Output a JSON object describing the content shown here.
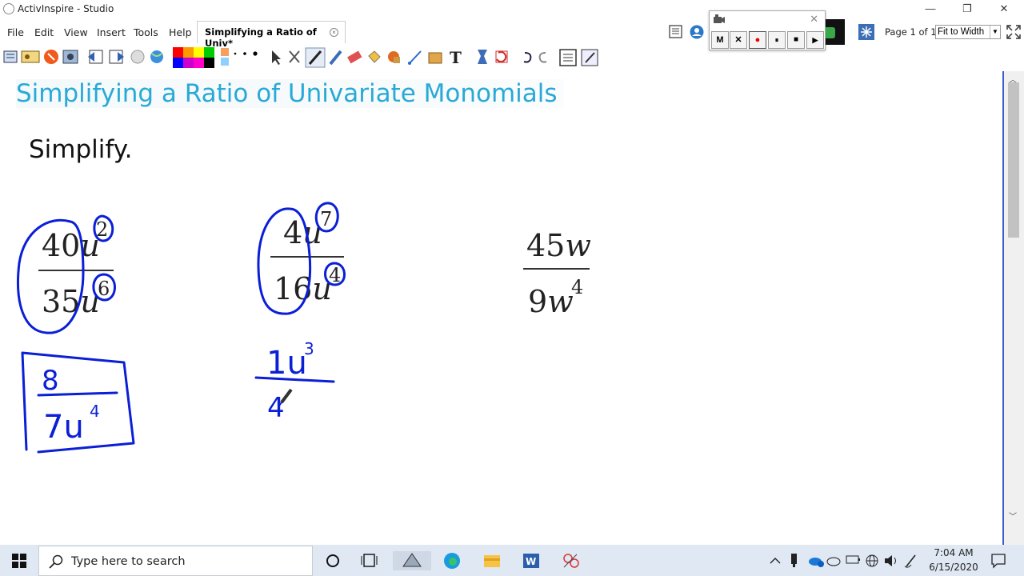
{
  "window": {
    "title": "ActivInspire - Studio",
    "minimize_glyph": "—",
    "maximize_glyph": "❐",
    "close_glyph": "✕"
  },
  "menu": {
    "items": [
      "File",
      "Edit",
      "View",
      "Insert",
      "Tools",
      "Help"
    ]
  },
  "document_tab": {
    "label": "Simplifying a Ratio of Univ*",
    "close_glyph": "×"
  },
  "recorder": {
    "close_glyph": "✕",
    "buttons": [
      "M",
      "✕",
      "●",
      "⏸",
      "■",
      "▶"
    ]
  },
  "navigation": {
    "page_indicator": "Page 1 of 1",
    "zoom_value": "Fit to Width"
  },
  "palette": {
    "colors_row1": [
      "#ff0000",
      "#ff9900",
      "#ffff00",
      "#00cc00"
    ],
    "colors_row2": [
      "#0000ff",
      "#cc00cc",
      "#ff00cc",
      "#000000"
    ]
  },
  "canvas": {
    "heading": "Simplifying a Ratio of Univariate Monomials",
    "instruction": "Simplify.",
    "problems": [
      {
        "num_coef": "40",
        "num_var": "u",
        "num_exp": "2",
        "den_coef": "35",
        "den_var": "u",
        "den_exp": "6"
      },
      {
        "num_coef": "4",
        "num_var": "u",
        "num_exp": "7",
        "den_coef": "16",
        "den_var": "u",
        "den_exp": "4"
      },
      {
        "num_coef": "45",
        "num_var": "w",
        "num_exp": "",
        "den_coef": "9",
        "den_var": "w",
        "den_exp": "4"
      }
    ],
    "ink_color": "#0a1fd6",
    "handwritten": {
      "answer1_num": "8",
      "answer1_den": "7u",
      "answer1_exp": "4",
      "answer2_num": "1u",
      "answer2_exp": "3",
      "answer2_den": "4"
    }
  },
  "taskbar": {
    "search_placeholder": "Type here to search",
    "time": "7:04 AM",
    "date": "6/15/2020"
  }
}
